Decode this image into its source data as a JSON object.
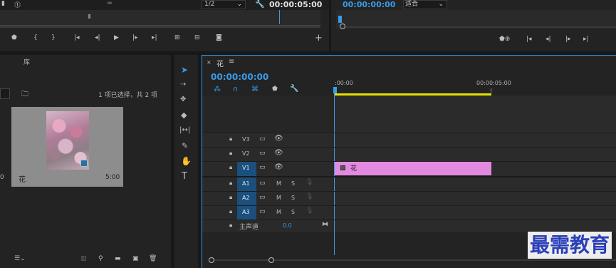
{
  "source_monitor": {
    "resolution": "1/2",
    "timecode": "00:00:05:00"
  },
  "program_monitor": {
    "timecode": "00:00:00:00",
    "fit": "适合"
  },
  "project": {
    "tab": "库",
    "selection_status": "1 项已选择，共 2 项",
    "clip_name": "花",
    "clip_duration": "5:00"
  },
  "timeline": {
    "sequence_name": "花",
    "timecode": "00:00:00:00",
    "ruler_start": ":00:00",
    "ruler_end": "00:00:05:00",
    "video_tracks": [
      "V3",
      "V2",
      "V1"
    ],
    "audio_tracks": [
      "A1",
      "A2",
      "A3"
    ],
    "master_label": "主声道",
    "master_value": "0.0",
    "mute_label": "M",
    "solo_label": "S",
    "clip_label": "花"
  },
  "watermark": "最需教育",
  "colors": {
    "accent_blue": "#3a9be6",
    "clip_pink": "#e28ae0",
    "track_active": "#1b4f7c",
    "work_area_yellow": "#e6e000"
  }
}
